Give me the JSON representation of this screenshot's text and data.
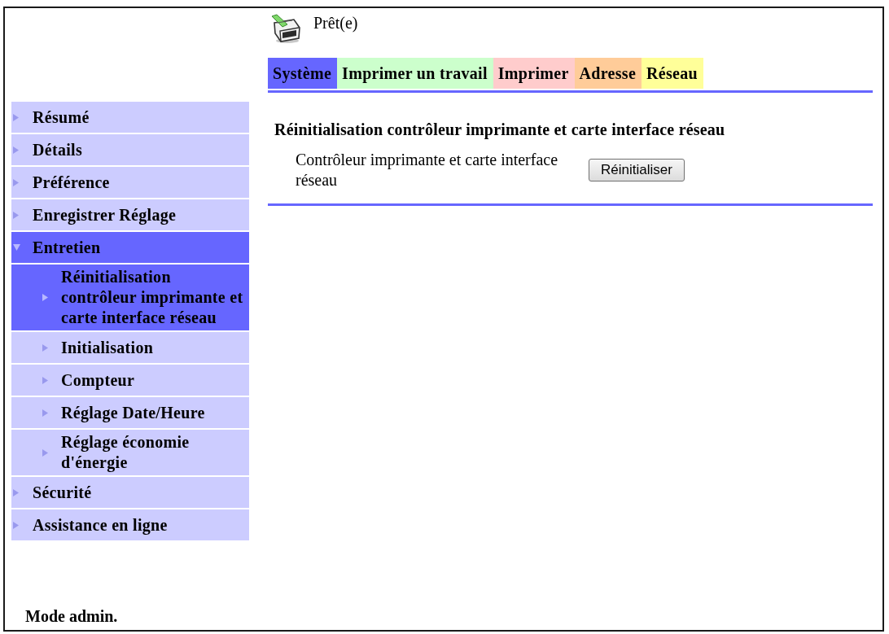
{
  "status": {
    "text": "Prêt(e)"
  },
  "tabs": [
    {
      "label": "Système",
      "color": "#6666ff",
      "selected": true
    },
    {
      "label": "Imprimer un travail",
      "color": "#ccffcc",
      "selected": false
    },
    {
      "label": "Imprimer",
      "color": "#ffcccc",
      "selected": false
    },
    {
      "label": "Adresse",
      "color": "#ffcc99",
      "selected": false
    },
    {
      "label": "Réseau",
      "color": "#ffff99",
      "selected": false
    }
  ],
  "sidebar": {
    "items": [
      {
        "label": "Résumé",
        "selected": false,
        "expanded": false
      },
      {
        "label": "Détails",
        "selected": false,
        "expanded": false
      },
      {
        "label": "Préférence",
        "selected": false,
        "expanded": false
      },
      {
        "label": "Enregistrer Réglage",
        "selected": false,
        "expanded": false
      },
      {
        "label": "Entretien",
        "selected": true,
        "expanded": true,
        "children": [
          {
            "label": "Réinitialisation contrôleur imprimante et carte interface réseau",
            "selected": true
          },
          {
            "label": "Initialisation",
            "selected": false
          },
          {
            "label": "Compteur",
            "selected": false
          },
          {
            "label": "Réglage Date/Heure",
            "selected": false
          },
          {
            "label": "Réglage économie d'énergie",
            "selected": false
          }
        ]
      },
      {
        "label": "Sécurité",
        "selected": false,
        "expanded": false
      },
      {
        "label": "Assistance en ligne",
        "selected": false,
        "expanded": false
      }
    ],
    "footer": "Mode admin."
  },
  "content": {
    "title": "Réinitialisation contrôleur imprimante et carte interface réseau",
    "rows": [
      {
        "label": "Contrôleur imprimante et carte interface réseau",
        "button": "Réinitialiser"
      }
    ]
  }
}
